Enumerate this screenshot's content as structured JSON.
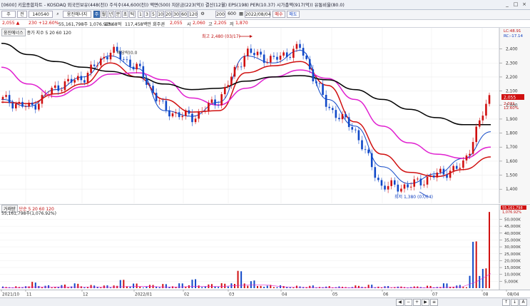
{
  "window": {
    "title": "[0600] 키움종합차트 - KOSDAQ 외국인보유(448(천)) 주식수(44,600(천)) 액면(500) 자본금(223(억)) 결산(12월) EPS(198) PER(10.37) 시가총액(917(억)) 유통비율(80.0)",
    "min": "_",
    "max": "□",
    "close": "×"
  },
  "toolbar": {
    "mode": "주",
    "chart_type": "전",
    "code": "140540",
    "name": "웅진에너지",
    "periods": [
      "주",
      "월",
      "년",
      "분",
      "초",
      "틱"
    ],
    "minutes": [
      "1",
      "3",
      "5",
      "10",
      "20",
      "30",
      "60",
      "120"
    ],
    "count": "200",
    "count_max": "600",
    "date": "2022/08/04",
    "buy": "매수",
    "sell": "매도"
  },
  "quote": {
    "price": "2,055 ▲",
    "change": "230 +12.60%",
    "volume": "55,161,798주 1,076.92%",
    "amount": "23.68억",
    "value": "117,458백만 회주권",
    "open_label": "시",
    "open": "2,060",
    "close_label": "2,055",
    "high_label": "고",
    "high": "2,205",
    "low_label": "저",
    "low": "1,870"
  },
  "price_panel": {
    "legend_name": "웅진에너스",
    "legend_ma": "종가 지수 5 20 60 120",
    "annotation_high": "최고 2,480 (03/17)",
    "annotation_low": "최저 1,380 (07/04)",
    "annotation_mid": "배당락(0.0",
    "ld_label": "LC:48.91",
    "rc_label": "RC:-17.14",
    "current_price": "2,055",
    "right_labels": [
      "2,031",
      "12.60%"
    ]
  },
  "volume_panel": {
    "legend_name": "거래량",
    "legend_ma": "단순 5 20 60 120",
    "legend_value": "55,161,798주(1,076.92%)",
    "current_volume": "55,161,798",
    "current_pct": "1,076.92%"
  },
  "colors": {
    "up": "#d01010",
    "down": "#1048c8",
    "ma5": "#1048c8",
    "ma20": "#d01010",
    "ma60": "#e020d0",
    "ma120": "#000000"
  },
  "chart_data": [
    {
      "type": "line",
      "title": "",
      "xlabel": "",
      "ylabel": "",
      "ylim": [
        1330,
        2520
      ],
      "x_ticks": [
        "2021/10",
        "11",
        "12",
        "2022/01",
        "02",
        "03",
        "04",
        "05",
        "06",
        "07",
        "08",
        "08/04"
      ],
      "y_ticks": [
        "2,400",
        "2,300",
        "2,200",
        "2,100",
        "2,000",
        "1,900",
        "1,800",
        "1,700",
        "1,600",
        "1,500",
        "1,400"
      ],
      "series": [
        {
          "name": "5",
          "values": [
            2040,
            1990,
            2110,
            2200,
            2350,
            2260,
            1960,
            1920,
            2020,
            2350,
            2300,
            2390,
            2040,
            1850,
            1560,
            1440,
            1510,
            1620,
            1810
          ]
        },
        {
          "name": "20",
          "values": [
            2020,
            2010,
            2080,
            2150,
            2300,
            2200,
            2040,
            1950,
            1960,
            2230,
            2280,
            2310,
            2140,
            1880,
            1650,
            1520,
            1490,
            1540,
            1630
          ]
        },
        {
          "name": "60",
          "values": [
            2270,
            2150,
            2060,
            2130,
            2220,
            2230,
            2180,
            2050,
            2000,
            2120,
            2200,
            2250,
            2190,
            2040,
            1850,
            1730,
            1650,
            1620,
            1700
          ]
        },
        {
          "name": "120",
          "values": [
            2440,
            2360,
            2310,
            2270,
            2240,
            2200,
            2150,
            2110,
            2120,
            2170,
            2200,
            2210,
            2180,
            2110,
            2040,
            1970,
            1910,
            1860,
            1860
          ]
        }
      ],
      "close_values": [
        2040,
        1980,
        2130,
        2200,
        2390,
        2260,
        1960,
        1910,
        2040,
        2380,
        2320,
        2410,
        1990,
        1830,
        1420,
        1420,
        1500,
        1560,
        2055
      ]
    },
    {
      "type": "bar",
      "title": "",
      "xlabel": "",
      "ylabel": "",
      "ylim": [
        0,
        57000
      ],
      "y_ticks": [
        "50,000K",
        "45,000K",
        "40,000K",
        "35,000K",
        "30,000K",
        "25,000K",
        "20,000K",
        "15,000K",
        "10,000K",
        "5,000K"
      ],
      "series": [
        {
          "name": "거래량",
          "values": [
            1200,
            800,
            4000,
            1500,
            2000,
            3000,
            1800,
            1500,
            5500,
            3000,
            2000,
            2500,
            3000,
            6000,
            2500,
            3000,
            12000,
            5000,
            1800,
            1500,
            1200,
            1400,
            900,
            800,
            1500,
            2000,
            1000,
            800,
            900,
            1200,
            3000,
            1800,
            33500,
            55161
          ]
        }
      ]
    }
  ]
}
